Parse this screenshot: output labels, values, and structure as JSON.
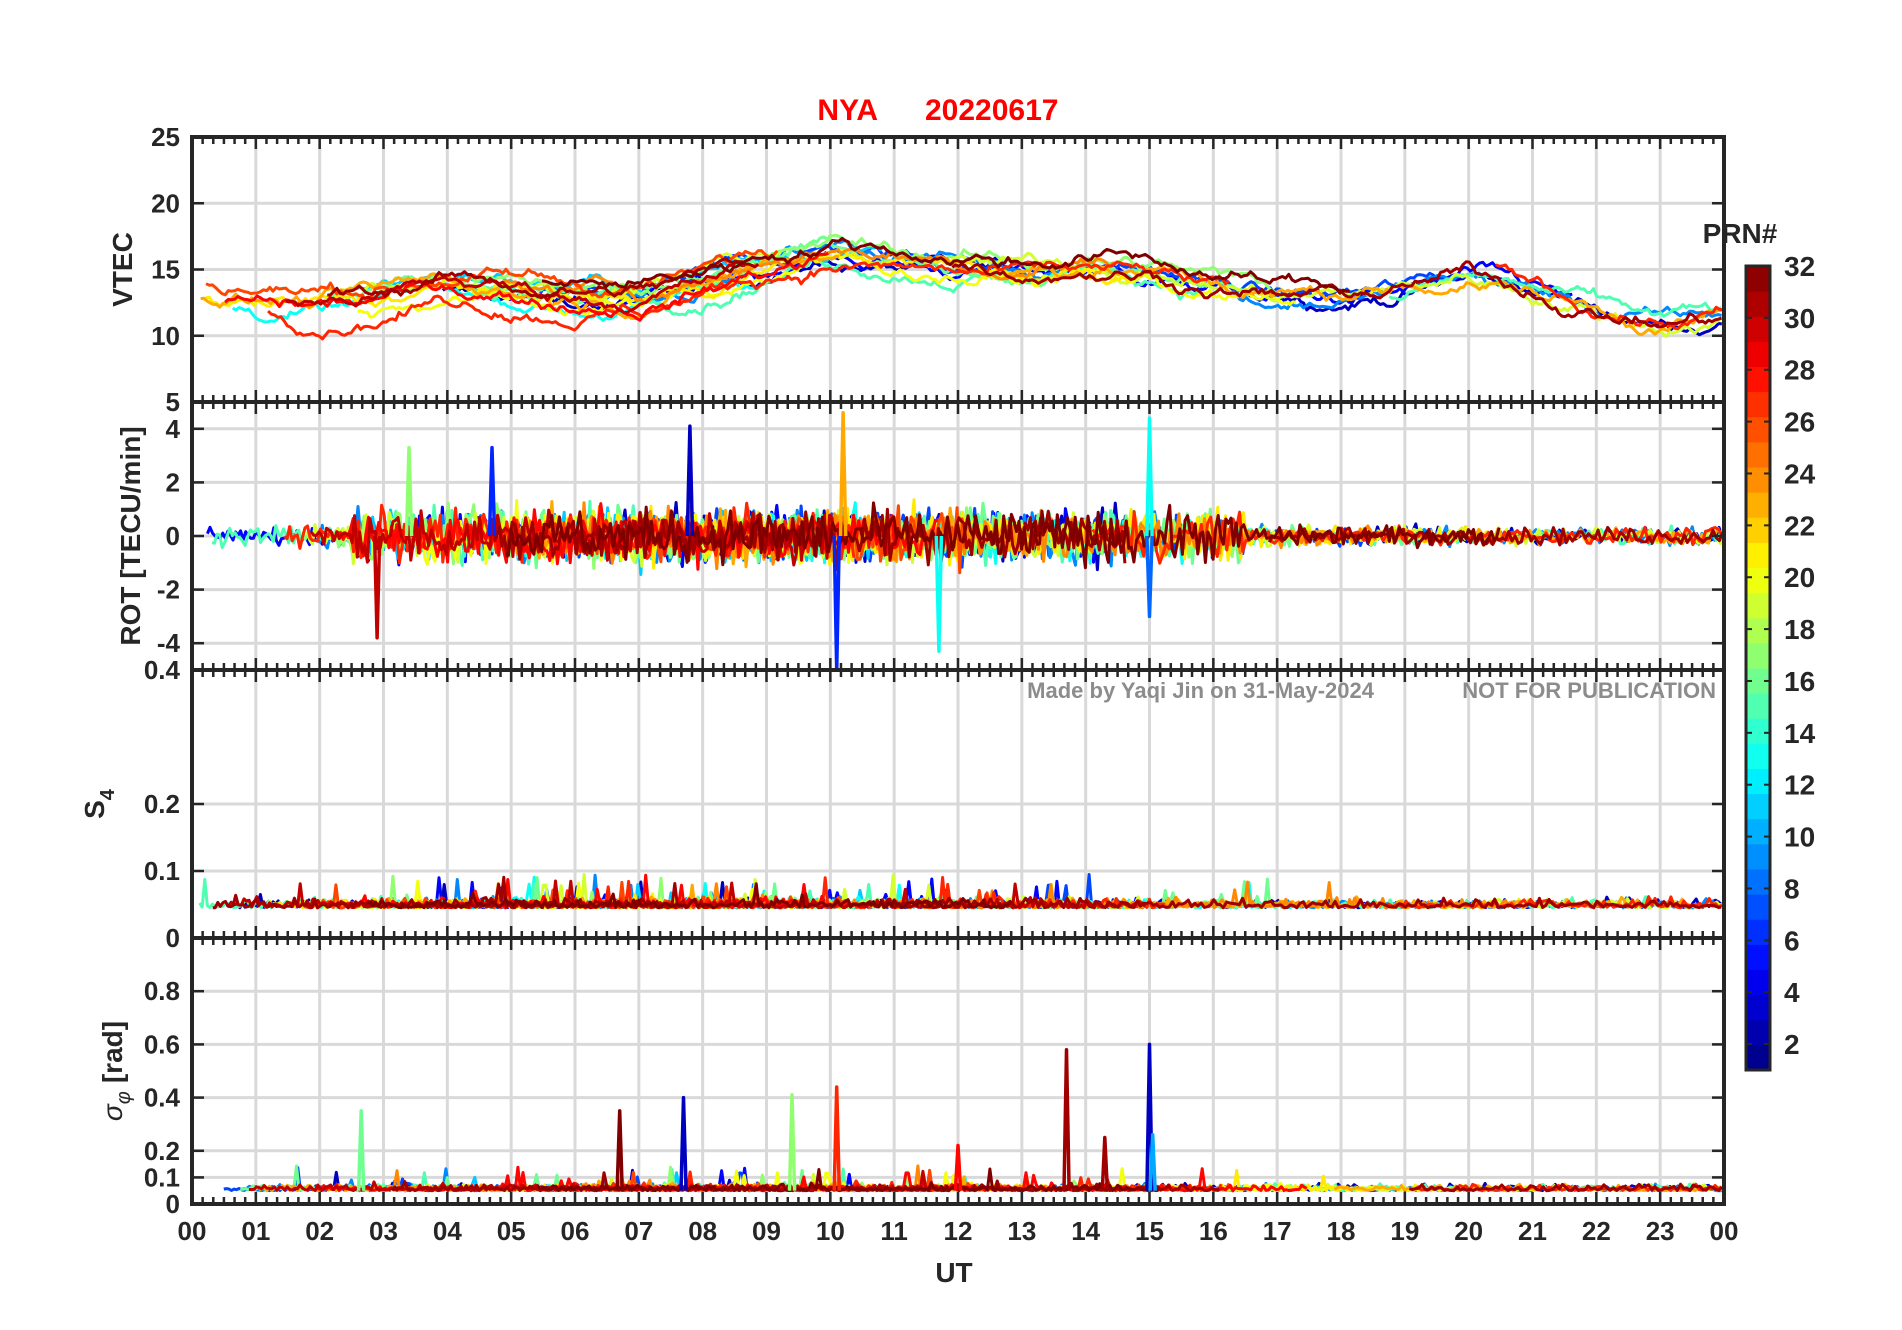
{
  "title": {
    "station": "NYA",
    "date": "20220617"
  },
  "watermark": {
    "author": "Made by Yaqi Jin on 31-May-2024",
    "notice": "NOT FOR PUBLICATION"
  },
  "colors": {
    "title": "#ff0000",
    "axis": "#262626",
    "grid": "#d9d9d9",
    "watermark": "#8c8c8c",
    "colormap": "jet"
  },
  "chart_data": {
    "type": "line",
    "x_axis": {
      "label": "UT",
      "range": [
        0,
        24
      ],
      "tick_labels": [
        "00",
        "01",
        "02",
        "03",
        "04",
        "05",
        "06",
        "07",
        "08",
        "09",
        "10",
        "11",
        "12",
        "13",
        "14",
        "15",
        "16",
        "17",
        "18",
        "19",
        "20",
        "21",
        "22",
        "23",
        "00"
      ]
    },
    "colorbar": {
      "label": "PRN#",
      "range": [
        1,
        32
      ],
      "tick_labels": [
        "2",
        "4",
        "6",
        "8",
        "10",
        "12",
        "14",
        "16",
        "18",
        "20",
        "22",
        "24",
        "26",
        "28",
        "30",
        "32"
      ],
      "grid": false
    },
    "panels": [
      {
        "key": "vtec",
        "ylabel": "VTEC",
        "ylim": [
          5,
          25
        ],
        "yticks": [
          10,
          15,
          20,
          25
        ],
        "ytick_labels": [
          "10",
          "15",
          "20",
          "25"
        ],
        "bottom_label": "5",
        "grid": true,
        "series_description": "per-PRN VTEC traces; values mostly 10-18, peak ~22.5 near 10 UT",
        "envelope": {
          "x": [
            0,
            2,
            3,
            4,
            5,
            6,
            7,
            8,
            9,
            10,
            11,
            12,
            13,
            14,
            15,
            16,
            17,
            18,
            19,
            20,
            21,
            22,
            23,
            24
          ],
          "y": [
            13,
            12.5,
            13,
            14,
            13.5,
            13,
            13,
            14,
            15.5,
            16.5,
            16,
            15.5,
            15,
            15.5,
            15,
            14,
            13,
            13,
            13.5,
            14.5,
            13.5,
            12,
            11,
            11.5
          ]
        }
      },
      {
        "key": "rot",
        "ylabel": "ROT [TECU/min]",
        "ylim": [
          -5,
          5
        ],
        "yticks": [
          -4,
          -2,
          0,
          2,
          4
        ],
        "ytick_labels": [
          "-4",
          "-2",
          "0",
          "2",
          "4"
        ],
        "bottom_label": "0.4",
        "grid": true,
        "series_description": "per-PRN rate of TEC traces; fluctuations around 0, spikes to ~+4.6 and ~-5",
        "spikes": [
          {
            "x": 2.9,
            "y": -3.8
          },
          {
            "x": 3.4,
            "y": 3.3
          },
          {
            "x": 4.7,
            "y": 3.3
          },
          {
            "x": 7.8,
            "y": 4.1
          },
          {
            "x": 10.1,
            "y": -5.0
          },
          {
            "x": 10.2,
            "y": 4.6
          },
          {
            "x": 11.7,
            "y": -4.3
          },
          {
            "x": 15.0,
            "y": 4.4
          },
          {
            "x": 15.0,
            "y": -3.0
          }
        ]
      },
      {
        "key": "s4",
        "ylabel": "S",
        "ylabel_subscript": "4",
        "ylim": [
          0,
          0.4
        ],
        "yticks": [
          0,
          0.1,
          0.2
        ],
        "ytick_labels": [
          "0",
          "0.1",
          "0.2"
        ],
        "grid": true,
        "series_description": "per-PRN amplitude scintillation index; values mostly 0.03-0.1",
        "baseline": 0.045
      },
      {
        "key": "sigma_phi",
        "ylabel_symbol": "σ",
        "ylabel_subscript": "φ",
        "ylabel_unit": "[rad]",
        "ylim": [
          0,
          1.0
        ],
        "yticks": [
          0,
          0.1,
          0.2,
          0.4,
          0.6,
          0.8
        ],
        "ytick_labels": [
          "0",
          "0.1",
          "0.2",
          "0.4",
          "0.6",
          "0.8"
        ],
        "grid": true,
        "series_description": "per-PRN phase scintillation index; mostly below 0.15 with spikes",
        "spikes": [
          {
            "x": 2.65,
            "y": 0.35,
            "prn": 16
          },
          {
            "x": 6.7,
            "y": 0.35,
            "prn": 32
          },
          {
            "x": 7.7,
            "y": 0.4,
            "prn": 3
          },
          {
            "x": 9.4,
            "y": 0.41,
            "prn": 17
          },
          {
            "x": 10.1,
            "y": 0.44,
            "prn": 27
          },
          {
            "x": 12.0,
            "y": 0.22,
            "prn": 28
          },
          {
            "x": 13.7,
            "y": 0.58,
            "prn": 31
          },
          {
            "x": 14.3,
            "y": 0.25,
            "prn": 31
          },
          {
            "x": 15.0,
            "y": 0.6,
            "prn": 3
          },
          {
            "x": 15.05,
            "y": 0.26,
            "prn": 10
          }
        ]
      }
    ]
  }
}
